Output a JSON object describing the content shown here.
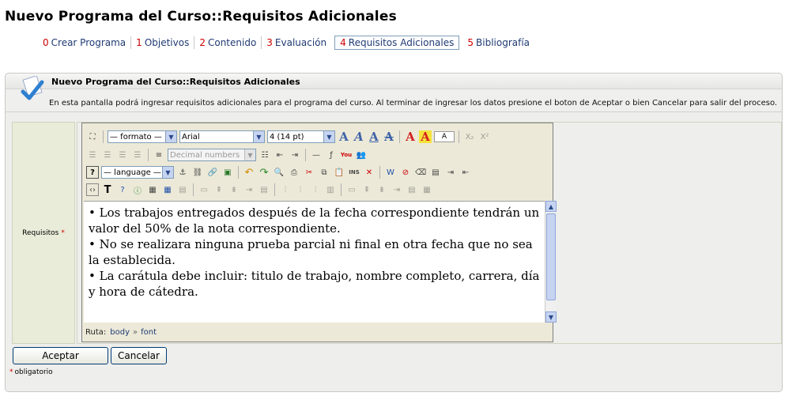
{
  "page": {
    "title": "Nuevo Programa del Curso::Requisitos Adicionales"
  },
  "steps": [
    {
      "num": "0",
      "label": "Crear Programa"
    },
    {
      "num": "1",
      "label": "Objetivos"
    },
    {
      "num": "2",
      "label": "Contenido"
    },
    {
      "num": "3",
      "label": "Evaluación"
    },
    {
      "num": "4",
      "label": "Requisitos Adicionales"
    },
    {
      "num": "5",
      "label": "Bibliografía"
    }
  ],
  "panel": {
    "title": "Nuevo Programa del Curso::Requisitos Adicionales",
    "description": "En esta pantalla podrá ingresar requisitos adicionales para el programa del curso. Al terminar de ingresar los datos presione el boton de Aceptar o bien Cancelar para salir del proceso."
  },
  "form": {
    "field_label": "Requisitos",
    "required_mark": "*"
  },
  "editor": {
    "format_select": "— formato —",
    "font_select": "Arial",
    "size_select": "4 (14 pt)",
    "list_select": "Decimal numbers",
    "language_select": "— language —",
    "content": [
      "• Los trabajos entregados después de la fecha correspondiente tendrán un valor del 50% de la nota correspondiente.",
      "• No se realizara ninguna prueba parcial ni final en otra fecha que no sea la establecida.",
      "• La carátula debe incluir: titulo de trabajo, nombre completo, carrera, día y hora de cátedra."
    ],
    "status_label": "Ruta:",
    "path_body": "body",
    "path_sep": "»",
    "path_font": "font",
    "box_letter": "A",
    "youtube_label": "You",
    "ins_label": "INS"
  },
  "buttons": {
    "accept": "Aceptar",
    "cancel": "Cancelar"
  },
  "footer": {
    "required_note": "obligatorio"
  },
  "colors": {
    "step_number": "#cc0000",
    "link": "#1f3a73",
    "panel_bg": "#eeeeec",
    "label_bg": "#e8ecd8"
  }
}
